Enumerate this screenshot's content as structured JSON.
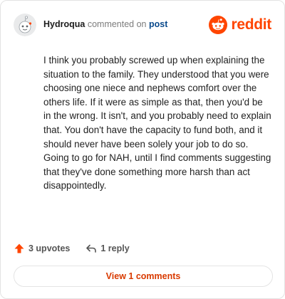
{
  "comment": {
    "username": "Hydroqua",
    "commented_on_text": "commented on",
    "post_link": "post",
    "body": "I think you probably screwed up when explaining the situation to the family. They understood that you were choosing one niece and nephews comfort over the others life. If it were as simple as that, then you'd be in the wrong. It isn't, and you probably need to explain that. You don't have the capacity to fund both, and it should never have been solely your job to do so. Going to go for NAH, until I find comments suggesting that they've done something more harsh than act disappointedly."
  },
  "brand": {
    "wordmark": "reddit",
    "icon": "reddit-snoo-icon",
    "color": "#ff4500"
  },
  "actions": {
    "upvotes_label": "3 upvotes",
    "upvote_icon": "upvote-arrow-icon",
    "reply_label": "1 reply",
    "reply_icon": "reply-arrow-icon"
  },
  "footer": {
    "view_comments_label": "View 1 comments",
    "accent": "#d93a00"
  }
}
